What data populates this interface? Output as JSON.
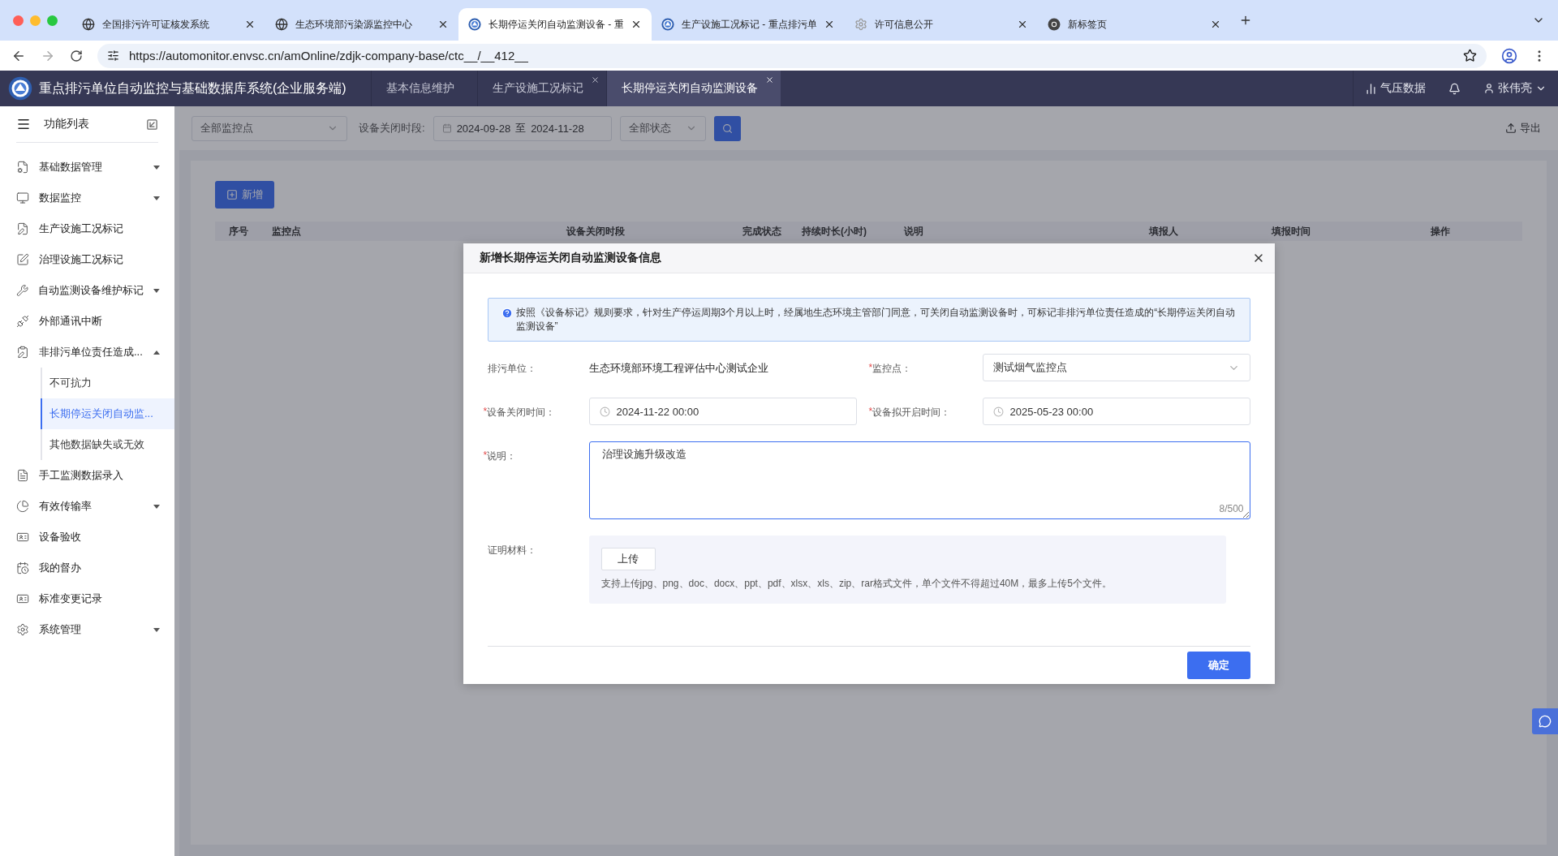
{
  "browser": {
    "tabs": [
      {
        "title": "全国排污许可证核发系统",
        "selected": false
      },
      {
        "title": "生态环境部污染源监控中心",
        "selected": false
      },
      {
        "title": "长期停运关闭自动监测设备 - 重",
        "selected": true
      },
      {
        "title": "生产设施工况标记 - 重点排污单",
        "selected": false
      },
      {
        "title": "许可信息公开",
        "selected": false
      },
      {
        "title": "新标签页",
        "selected": false
      }
    ],
    "url": "https://automonitor.envsc.cn/amOnline/zdjk-company-base/ctc__/__412__"
  },
  "app": {
    "title": "重点排污单位自动监控与基础数据库系统(企业服务端)",
    "tabs": [
      {
        "label": "基本信息维护",
        "selected": false,
        "closable": false
      },
      {
        "label": "生产设施工况标记",
        "selected": false,
        "closable": true
      },
      {
        "label": "长期停运关闭自动监测设备",
        "selected": true,
        "closable": true
      }
    ],
    "pressure_link": "气压数据",
    "user": "张伟亮"
  },
  "sidebar": {
    "title": "功能列表",
    "items": [
      {
        "label": "基础数据管理",
        "expandable": true,
        "expanded": false
      },
      {
        "label": "数据监控",
        "expandable": true,
        "expanded": false
      },
      {
        "label": "生产设施工况标记",
        "expandable": false
      },
      {
        "label": "治理设施工况标记",
        "expandable": false
      },
      {
        "label": "自动监测设备维护标记",
        "expandable": true,
        "expanded": false
      },
      {
        "label": "外部通讯中断",
        "expandable": false
      },
      {
        "label": "非排污单位责任造成...",
        "expandable": true,
        "expanded": true,
        "children": [
          {
            "label": "不可抗力",
            "selected": false
          },
          {
            "label": "长期停运关闭自动监...",
            "selected": true
          },
          {
            "label": "其他数据缺失或无效",
            "selected": false
          }
        ]
      },
      {
        "label": "手工监测数据录入",
        "expandable": false
      },
      {
        "label": "有效传输率",
        "expandable": true,
        "expanded": false
      },
      {
        "label": "设备验收",
        "expandable": false
      },
      {
        "label": "我的督办",
        "expandable": false
      },
      {
        "label": "标准变更记录",
        "expandable": false
      },
      {
        "label": "系统管理",
        "expandable": true,
        "expanded": false
      }
    ]
  },
  "filters": {
    "point": "全部监控点",
    "period_label": "设备关闭时段:",
    "date_start": "2024-09-28",
    "date_separator": "至",
    "date_end": "2024-11-28",
    "status": "全部状态",
    "export": "导出"
  },
  "table": {
    "add_button": "新增",
    "columns": [
      "序号",
      "监控点",
      "设备关闭时段",
      "完成状态",
      "持续时长(小时)",
      "说明",
      "填报人",
      "填报时间",
      "操作"
    ]
  },
  "dialog": {
    "title": "新增长期停运关闭自动监测设备信息",
    "notice": "按照《设备标记》规则要求，针对生产停运周期3个月以上时，经属地生态环境主管部门同意，可关闭自动监测设备时，可标记非排污单位责任造成的“长期停运关闭自动监测设备”",
    "fields": [
      {
        "kind": "text",
        "label": "排污单位：",
        "value": "生态环境部环境工程评估中心测试企业"
      },
      {
        "kind": "select",
        "label": "监控点：",
        "required_mark": "*",
        "value": "测试烟气监控点"
      },
      {
        "kind": "datetime",
        "label": "设备关闭时间：",
        "required_mark": "*",
        "value": "2024-11-22 00:00"
      },
      {
        "kind": "datetime",
        "label": "设备拟开启时间：",
        "required_mark": "*",
        "value": "2025-05-23 00:00"
      },
      {
        "kind": "textarea",
        "label": "说明：",
        "required_mark": "*",
        "value": "治理设施升级改造",
        "counter": "8/500"
      },
      {
        "kind": "upload",
        "label": "证明材料：",
        "button": "上传",
        "hint": "支持上传jpg、png、doc、docx、ppt、pdf、xlsx、xls、zip、rar格式文件，单个文件不得超过40M，最多上传5个文件。"
      }
    ],
    "confirm": "确定"
  }
}
